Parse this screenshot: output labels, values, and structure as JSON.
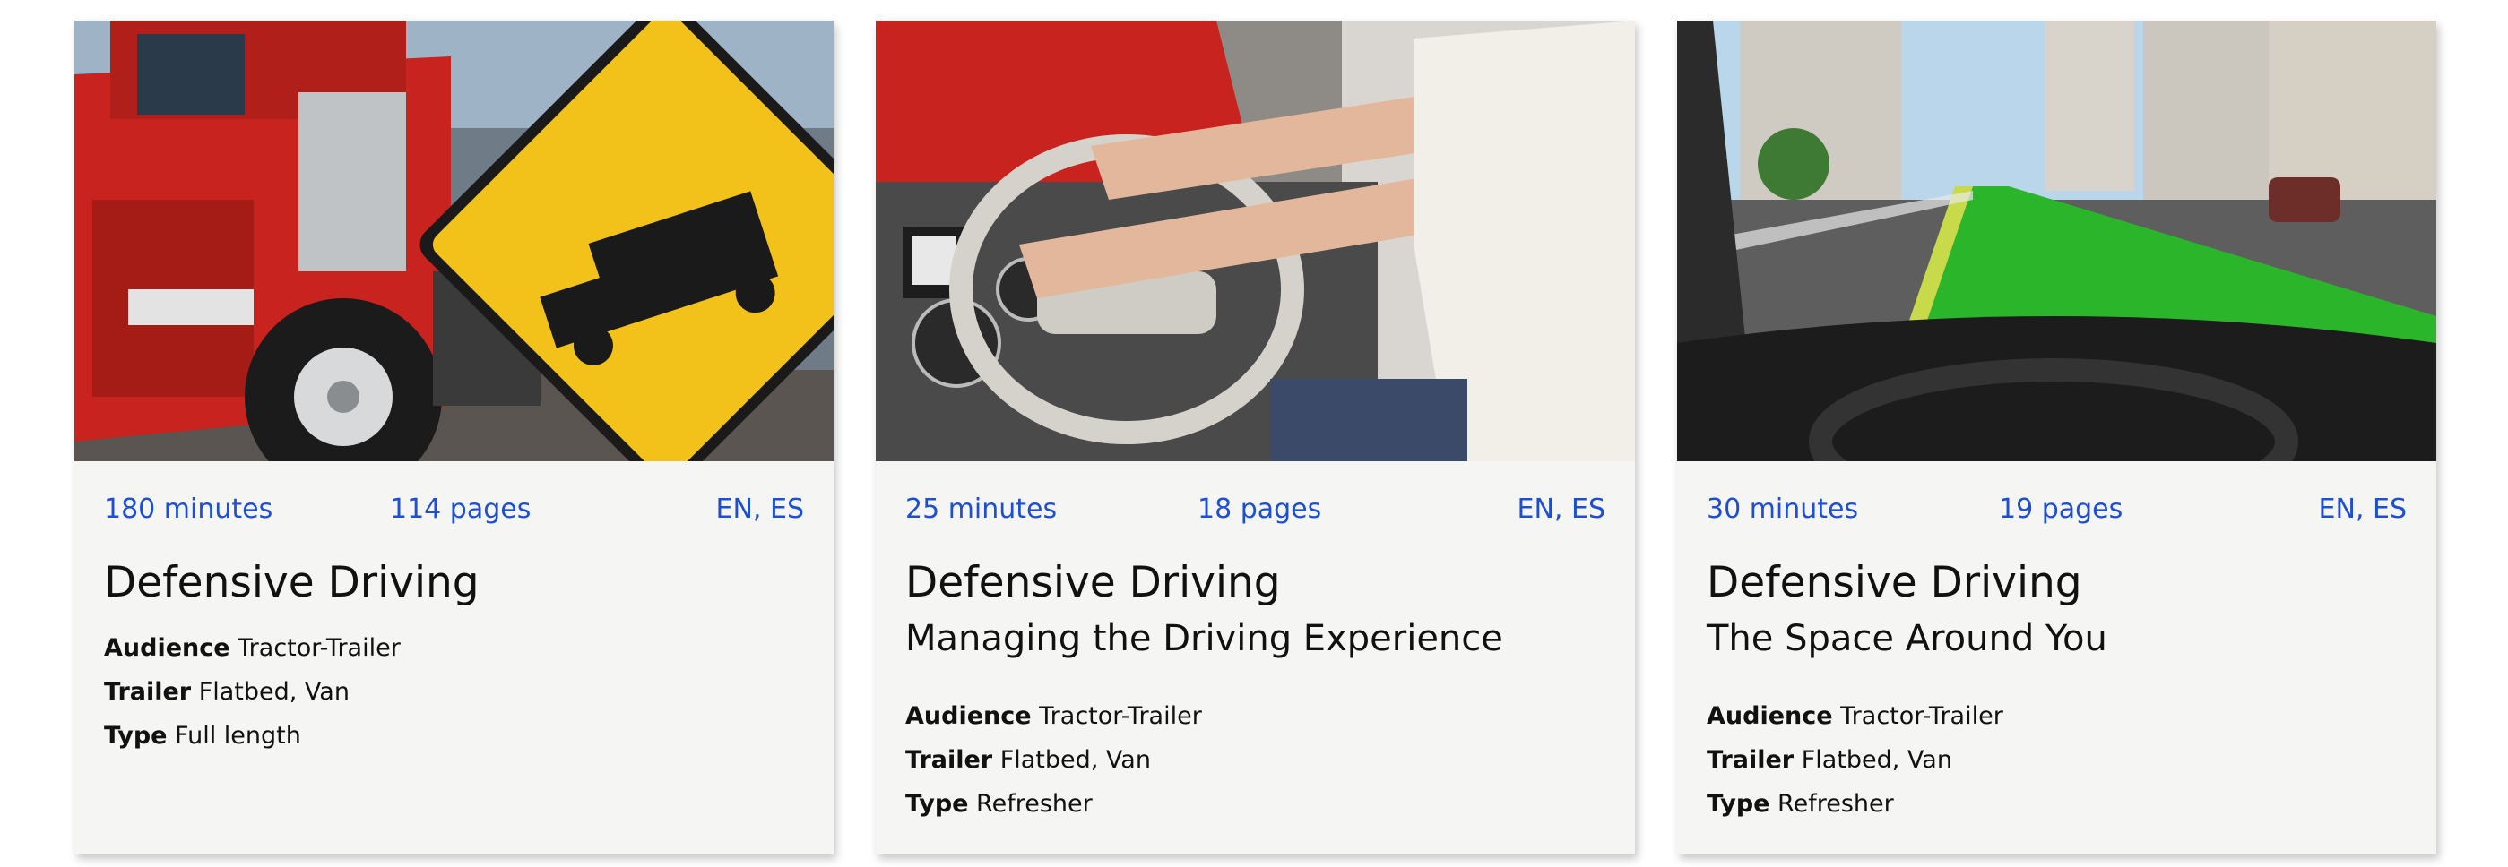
{
  "cards": [
    {
      "image_alt": "Red semi truck beside a yellow steep-grade truck warning sign",
      "duration": "180 minutes",
      "pages": "114 pages",
      "languages": "EN, ES",
      "title": "Defensive Driving",
      "subtitle": "",
      "audience_label": "Audience",
      "audience": "Tractor-Trailer",
      "trailer_label": "Trailer",
      "trailer": "Flatbed, Van",
      "type_label": "Type",
      "type": "Full length"
    },
    {
      "image_alt": "Driver's hands on the steering wheel inside a truck cab",
      "duration": "25 minutes",
      "pages": "18 pages",
      "languages": "EN, ES",
      "title": "Defensive Driving",
      "subtitle": "Managing the Driving Experience",
      "audience_label": "Audience",
      "audience": "Tractor-Trailer",
      "trailer_label": "Trailer",
      "trailer": "Flatbed, Van",
      "type_label": "Type",
      "type": "Refresher"
    },
    {
      "image_alt": "View through a truck windshield with the lane ahead highlighted green",
      "duration": "30 minutes",
      "pages": "19 pages",
      "languages": "EN, ES",
      "title": "Defensive Driving",
      "subtitle": "The Space Around You",
      "audience_label": "Audience",
      "audience": "Tractor-Trailer",
      "trailer_label": "Trailer",
      "trailer": "Flatbed, Van",
      "type_label": "Type",
      "type": "Refresher"
    }
  ],
  "colors": {
    "accent": "#1f4fd1",
    "card_background": "#f5f5f3",
    "text": "#111111"
  }
}
